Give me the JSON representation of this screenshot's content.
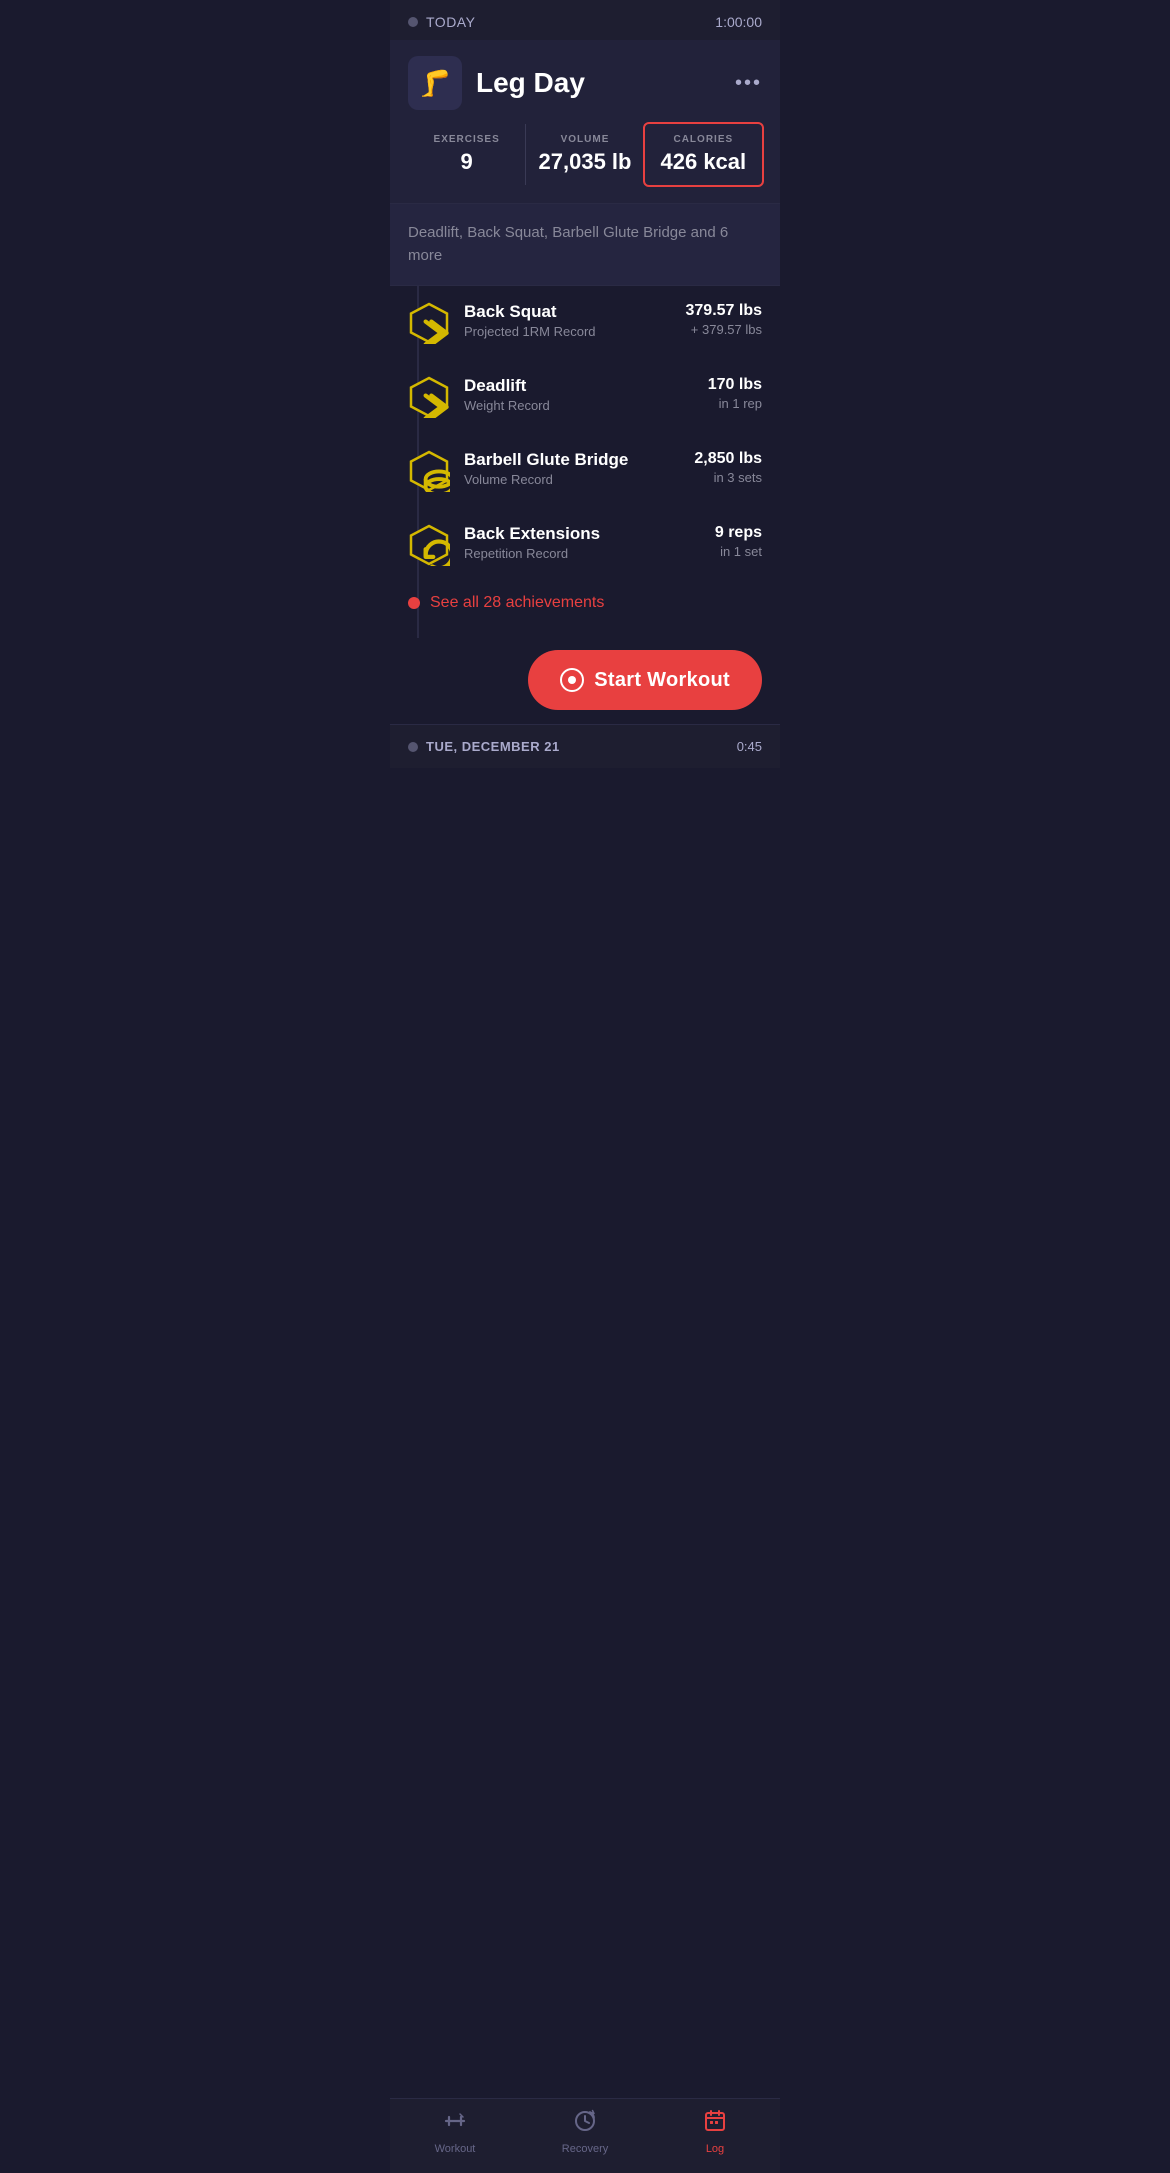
{
  "header": {
    "today_label": "TODAY",
    "time": "1:00:00"
  },
  "workout": {
    "name": "Leg Day",
    "icon": "🦵",
    "more_icon": "•••",
    "stats": {
      "exercises_label": "EXERCISES",
      "exercises_value": "9",
      "volume_label": "VOLUME",
      "volume_value": "27,035 lb",
      "calories_label": "CALORIES",
      "calories_value": "426 kcal"
    },
    "description": "Deadlift, Back Squat, Barbell Glute Bridge and 6 more"
  },
  "achievements": [
    {
      "name": "Back Squat",
      "type": "Projected 1RM Record",
      "value": "379.57 lbs",
      "sub": "+ 379.57 lbs",
      "icon_type": "arrows"
    },
    {
      "name": "Deadlift",
      "type": "Weight Record",
      "value": "170 lbs",
      "sub": "in 1 rep",
      "icon_type": "arrows"
    },
    {
      "name": "Barbell Glute Bridge",
      "type": "Volume Record",
      "value": "2,850 lbs",
      "sub": "in 3 sets",
      "icon_type": "weight"
    },
    {
      "name": "Back Extensions",
      "type": "Repetition Record",
      "value": "9 reps",
      "sub": "in 1 set",
      "icon_type": "refresh"
    }
  ],
  "see_all": {
    "label": "See all 28 achievements"
  },
  "start_workout": {
    "label": "Start Workout"
  },
  "next_workout": {
    "label": "TUE, DECEMBER 21",
    "time": "0:45"
  },
  "nav": {
    "items": [
      {
        "label": "Workout",
        "icon": "workout",
        "active": false
      },
      {
        "label": "Recovery",
        "icon": "recovery",
        "active": false
      },
      {
        "label": "Log",
        "icon": "log",
        "active": true
      }
    ]
  }
}
